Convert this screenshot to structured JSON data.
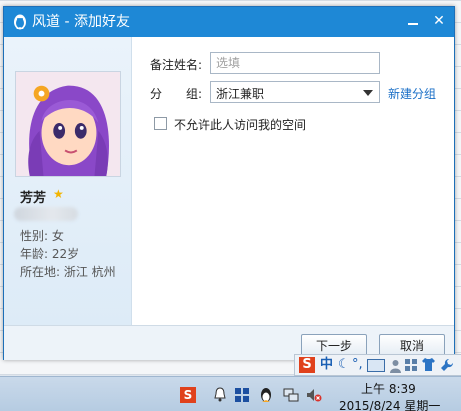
{
  "window": {
    "title": "风道 - 添加好友",
    "minimize_symbol": "—",
    "close_symbol": "✕",
    "title_bar_color": "#1e88d6"
  },
  "profile": {
    "nickname": "芳芳",
    "gender_line": "性别: 女",
    "age_line": "年龄: 22岁",
    "location_line": "所在地: 浙江  杭州"
  },
  "form": {
    "remark_label": "备注姓名:",
    "remark_placeholder": "选填",
    "remark_value": "",
    "group_label_a": "分",
    "group_label_b": "组:",
    "group_value": "浙江兼职",
    "new_group_link": "新建分组",
    "privacy_checkbox_label": "不允许此人访问我的空间",
    "privacy_checked": false
  },
  "buttons": {
    "next": "下一步",
    "cancel": "取消"
  },
  "ime": {
    "logo": "S",
    "mode": "中",
    "moon": "☾",
    "punct": "°,"
  },
  "taskbar": {
    "sogou_logo": "S",
    "time": "上午 8:39",
    "date": "2015/8/24 星期一"
  },
  "colors": {
    "link": "#1a6fc7",
    "accent": "#1e88d6"
  }
}
